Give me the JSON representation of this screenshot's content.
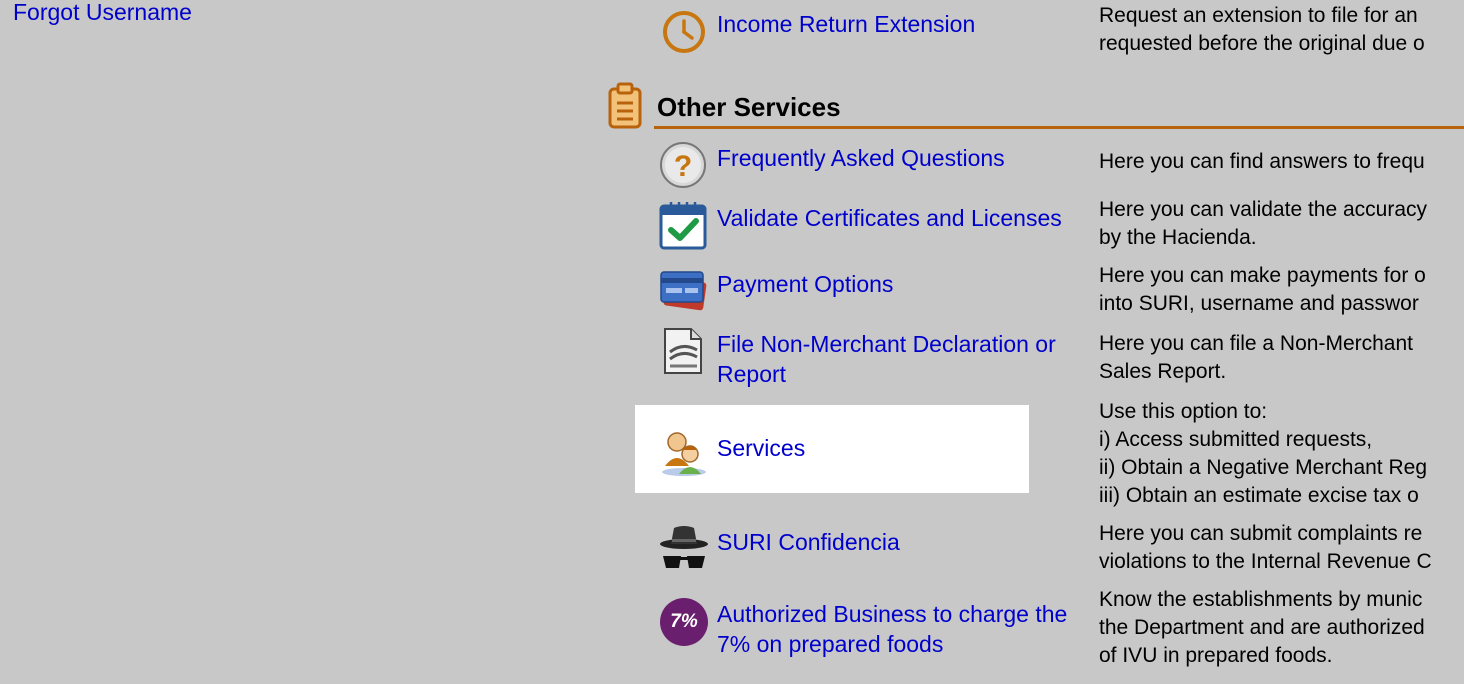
{
  "left_panel": {
    "forgot_username": "Forgot Username"
  },
  "top_item": {
    "label": "Income Return Extension",
    "desc_lines": [
      "Request an extension to file for an",
      "requested before the original due o"
    ]
  },
  "section": {
    "title": "Other Services"
  },
  "items": [
    {
      "label_lines": [
        "Frequently Asked Questions"
      ],
      "desc_lines": [
        "Here you can find answers to frequ"
      ]
    },
    {
      "label_lines": [
        "Validate Certificates and Licenses"
      ],
      "desc_lines": [
        "Here you can validate the accuracy",
        "by the Hacienda."
      ]
    },
    {
      "label_lines": [
        "Payment Options"
      ],
      "desc_lines": [
        "Here you can make payments for o",
        "into SURI, username and passwor"
      ]
    },
    {
      "label_lines": [
        "File Non-Merchant Declaration or",
        "Report"
      ],
      "desc_lines": [
        "Here you can file a Non-Merchant",
        "Sales Report."
      ]
    },
    {
      "label_lines": [
        "Services"
      ],
      "desc_lines": [
        "Use this option to:",
        "i) Access submitted requests,",
        "ii) Obtain a Negative Merchant Reg",
        "iii) Obtain an estimate excise tax o"
      ]
    },
    {
      "label_lines": [
        "SURI Confidencia"
      ],
      "desc_lines": [
        "Here you can submit complaints re",
        "violations to the Internal Revenue C"
      ]
    },
    {
      "label_lines": [
        "Authorized Business to charge the",
        "7% on prepared foods"
      ],
      "desc_lines": [
        "Know the establishments by munic",
        "the Department and are authorized",
        "of IVU in prepared foods."
      ],
      "badge_text": "7%"
    }
  ],
  "colors": {
    "background": "#c8c8c8",
    "link": "#0000cc",
    "section_rule": "#b8620c",
    "highlight": "#ffffff"
  }
}
